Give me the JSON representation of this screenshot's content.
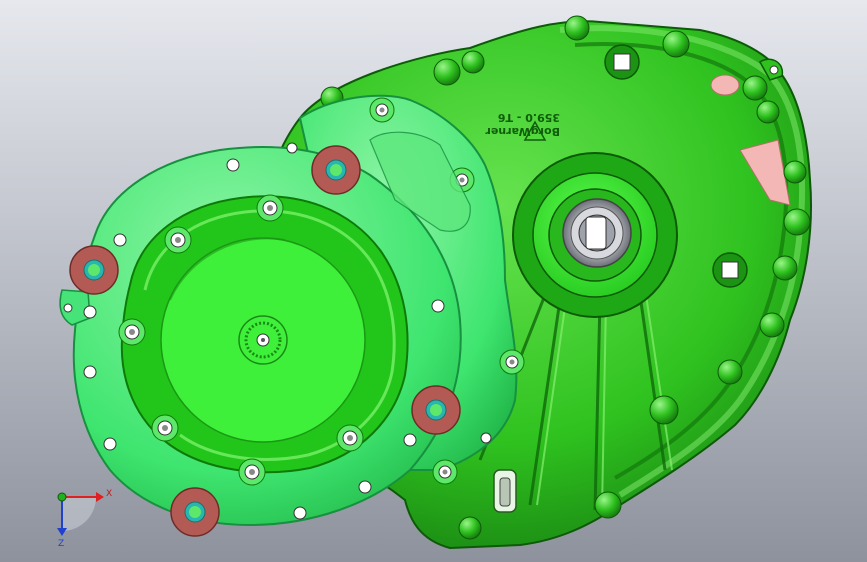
{
  "viewport": {
    "background_top": "#e6e8ee",
    "background_bottom": "#8d929d"
  },
  "colors": {
    "housing_dark": "#1c9e14",
    "housing_main": "#2fc21f",
    "housing_light": "#66e34f",
    "cover_main": "#3ee56f",
    "cover_light": "#8ff5a6",
    "bore_face": "#3ff03a",
    "bolt_ring": "#b35a55",
    "bolt_bore": "#29b5b0",
    "pink_face": "#f3b7b5",
    "axis_x": "#e02020",
    "axis_y": "#20b020",
    "axis_z": "#2040d0"
  },
  "casting_text": {
    "part_number": "359.0 - T6",
    "brand": "BorgWarner"
  },
  "triad": {
    "x_label": "X",
    "z_label": "Z"
  }
}
